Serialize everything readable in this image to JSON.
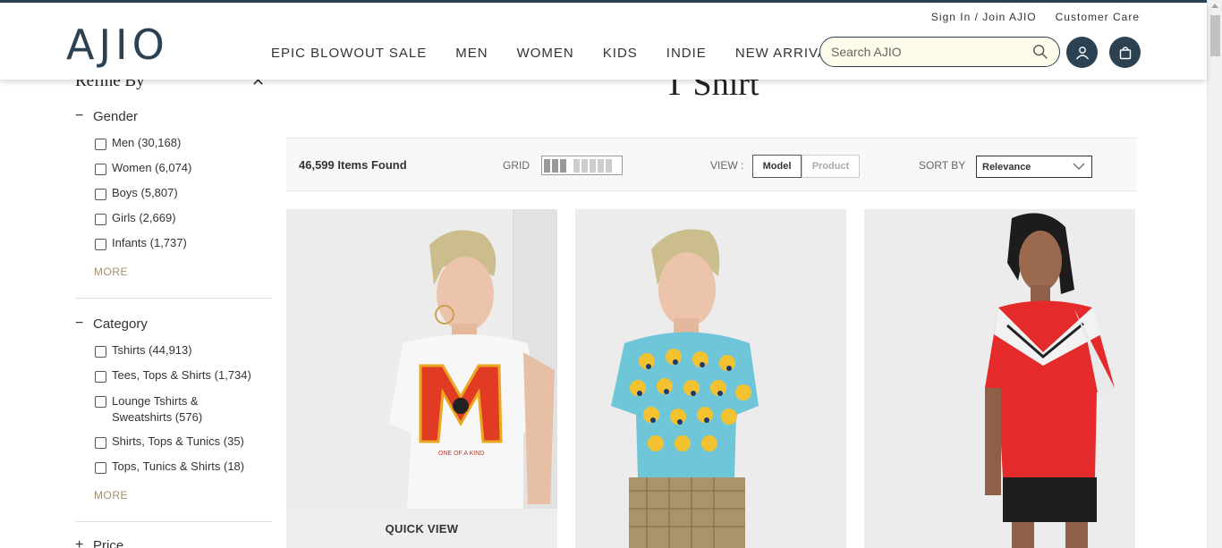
{
  "header": {
    "logo": "AJIO",
    "top_links": [
      "Sign In / Join AJIO",
      "Customer Care"
    ],
    "nav": [
      "EPIC BLOWOUT SALE",
      "MEN",
      "WOMEN",
      "KIDS",
      "INDIE",
      "NEW ARRIVALS"
    ],
    "search_placeholder": "Search AJIO",
    "brand_color": "#2c4152"
  },
  "sidebar": {
    "title": "Refine By",
    "facets": [
      {
        "title": "Gender",
        "options": [
          "Men (30,168)",
          "Women (6,074)",
          "Boys (5,807)",
          "Girls (2,669)",
          "Infants (1,737)"
        ],
        "more": "MORE"
      },
      {
        "title": "Category",
        "options": [
          "Tshirts (44,913)",
          "Tees, Tops & Shirts (1,734)",
          "Lounge Tshirts & Sweatshirts (576)",
          "Shirts, Tops & Tunics (35)",
          "Tops, Tunics & Shirts (18)"
        ],
        "more": "MORE"
      },
      {
        "title": "Price"
      }
    ]
  },
  "main": {
    "page_title": "T Shirt",
    "items_found": "46,599 Items Found",
    "grid_label": "GRID",
    "view_label": "VIEW :",
    "view_options": [
      "Model",
      "Product"
    ],
    "sort_label": "SORT BY",
    "sort_value": "Relevance",
    "quick_view": "QUICK VIEW"
  }
}
